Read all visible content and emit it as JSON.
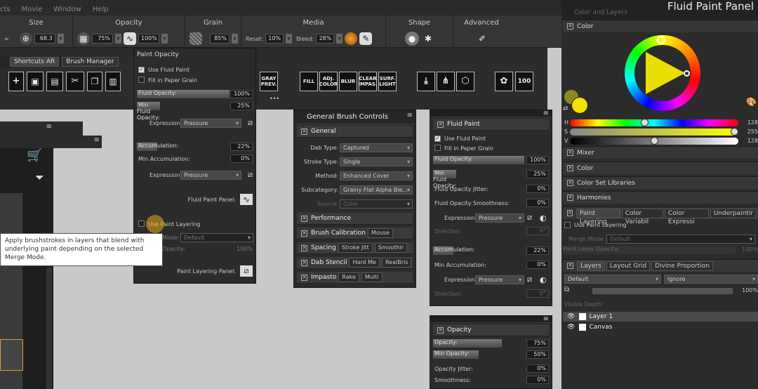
{
  "menu": [
    "cts",
    "Movie",
    "Window",
    "Help"
  ],
  "property_bar": {
    "size": {
      "label": "Size",
      "value": "68.3"
    },
    "opacity": {
      "label": "Opacity",
      "value": "75%",
      "value2": "100%"
    },
    "grain": {
      "label": "Grain",
      "value": "85%"
    },
    "media": {
      "label": "Media",
      "resat_label": "Resat:",
      "resat_value": "10%",
      "bleed_label": "Bleed:",
      "bleed_value": "28%"
    },
    "shape": {
      "label": "Shape"
    },
    "advanced": {
      "label": "Advanced"
    }
  },
  "toolbar": {
    "tabs": [
      "Shortcuts AR",
      "Brush Manager"
    ],
    "buttons": [
      "GRAY PREV.",
      "FILL",
      "ADJ. COLOR",
      "BLUR",
      "CLEAR IMPAS.",
      "SURF. LIGHT"
    ],
    "ellipsis": "•••"
  },
  "paint_opacity": {
    "title": "Paint Opacity",
    "use_fluid_paint": "Use Fluid Paint",
    "fill_in_paper_grain": "Fill in Paper Grain",
    "fluid_opacity_label": "Fluid Opacity:",
    "fluid_opacity_value": "100%",
    "fluid_opacity_fill": 1.0,
    "min_fluid_opacity_label": "Min Fluid Opacity:",
    "min_fluid_opacity_value": "25%",
    "min_fluid_opacity_fill": 0.25,
    "expression_label": "Expression:",
    "expression_value": "Pressure",
    "accumulation_label": "Accumulation:",
    "accumulation_value": "22%",
    "accumulation_fill": 0.22,
    "min_accumulation_label": "Min Accumulation:",
    "min_accumulation_value": "0%",
    "expression2_value": "Pressure",
    "fluid_paint_panel": "Fluid Paint Panel:",
    "use_paint_layering": "Use Paint Layering",
    "merge_mode_label": "Mode:",
    "merge_mode_value": "Default",
    "layer_opacity_label": "Opacity:",
    "layer_opacity_value": "100%",
    "paint_layering_panel": "Paint Layering Panel:"
  },
  "tooltip": "Apply brushstrokes in layers that blend with underlying paint depending on the selected Merge Mode.",
  "general_brush": {
    "title": "General Brush Controls",
    "general": "General",
    "dab_type_label": "Dab Type:",
    "dab_type": "Captured",
    "stroke_type_label": "Stroke Type:",
    "stroke_type": "Single",
    "method_label": "Method:",
    "method": "Enhanced Cover",
    "subcategory_label": "Subcategory:",
    "subcategory": "Grainy Flat Alpha Ble...",
    "source_label": "Source:",
    "source": "Color",
    "performance": "Performance",
    "brush_calibration": "Brush Calibration",
    "brush_calibration_tab": "Mouse",
    "spacing": "Spacing",
    "spacing_tabs": [
      "Stroke Jitt",
      "Smoothir"
    ],
    "dab_stencil": "Dab Stencil",
    "dab_stencil_tabs": [
      "Hard Me",
      "RealBris"
    ],
    "impasto": "Impasto",
    "impasto_tabs": [
      "Rake",
      "Multi"
    ]
  },
  "fluid_paint": {
    "title": "Fluid Paint",
    "use_fluid_paint": "Use Fluid Paint",
    "fill_in_paper_grain": "Fill in Paper Grain",
    "fluid_opacity_label": "Fluid Opacity:",
    "fluid_opacity_value": "100%",
    "fluid_opacity_fill": 1.0,
    "min_fluid_opacity_label": "Min Fluid Opacity:",
    "min_fluid_opacity_value": "25%",
    "min_fluid_opacity_fill": 0.25,
    "jitter_label": "Fluid Opacity Jitter:",
    "jitter_value": "0%",
    "smoothness_label": "Fluid Opacity Smoothness:",
    "smoothness_value": "0%",
    "expression_label": "Expression:",
    "expression_value": "Pressure",
    "direction_label": "Direction:",
    "direction_value": "0°",
    "accumulation_label": "Accumulation:",
    "accumulation_value": "22%",
    "accumulation_fill": 0.22,
    "min_accumulation_label": "Min Accumulation:",
    "min_accumulation_value": "0%",
    "expression2_value": "Pressure",
    "direction2_value": "0°"
  },
  "opacity_panel": {
    "title": "Opacity",
    "opacity_label": "Opacity:",
    "opacity_value": "75%",
    "opacity_fill": 0.75,
    "min_opacity_label": "Min Opacity:",
    "min_opacity_value": "50%",
    "min_opacity_fill": 0.5,
    "jitter_label": "Opacity Jitter:",
    "jitter_value": "0%",
    "smoothness_label": "Smoothness:",
    "smoothness_value": "0%"
  },
  "right_panel": {
    "header": "Color and Layers",
    "title_overlay": "Fluid Paint Panel",
    "color_section": "Color",
    "h_label": "H",
    "h_value": "128",
    "h_level": 0.44,
    "s_label": "S",
    "s_value": "255",
    "s_level": 1.0,
    "v_label": "V",
    "v_value": "128",
    "v_level": 0.5,
    "mixer": "Mixer",
    "color": "Color",
    "color_set_libraries": "Color Set Libraries",
    "harmonies": "Harmonies",
    "tabs": [
      "Paint Layering",
      "Color Variabil",
      "Color Expressi",
      "Underpaintir"
    ],
    "use_paint_layering": "Use Paint Layering",
    "merge_mode_label": "Merge Mode:",
    "merge_mode_value": "Default",
    "paint_layer_opacity_label": "Paint Layer Opacity:",
    "paint_layer_opacity_value": "100%",
    "layer_tabs": [
      "Layers",
      "Layout Grid",
      "Divine Proportion"
    ],
    "composite_method": "Default",
    "composite_depth": "Ignore",
    "layer_opacity_value": "100%",
    "visible_depth_label": "Visible Depth:",
    "layers": [
      "Layer 1",
      "Canvas"
    ]
  },
  "colors": {
    "accent": "#e0a830",
    "primary_color": "#f5e000"
  }
}
